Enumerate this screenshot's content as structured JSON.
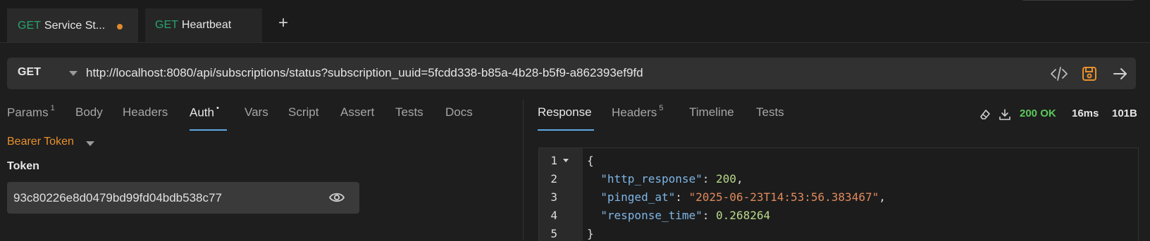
{
  "tabs": [
    {
      "method": "GET",
      "name": "Service St...",
      "unsaved": true
    },
    {
      "method": "GET",
      "name": "Heartbeat",
      "unsaved": false
    }
  ],
  "new_tab_label": "+",
  "request": {
    "method": "GET",
    "url": "http://localhost:8080/api/subscriptions/status?subscription_uuid=5fcdd338-b85a-4b28-b5f9-a862393ef9fd"
  },
  "request_tabs": {
    "params": "Params",
    "params_count": "1",
    "body": "Body",
    "headers": "Headers",
    "auth": "Auth",
    "auth_mark": "•",
    "vars": "Vars",
    "script": "Script",
    "assert": "Assert",
    "tests": "Tests",
    "docs": "Docs"
  },
  "auth": {
    "mode": "Bearer Token",
    "token_label": "Token",
    "token_value": "93c80226e8d0479bd99fd04bdb538c77"
  },
  "response_tabs": {
    "response": "Response",
    "headers": "Headers",
    "headers_count": "5",
    "timeline": "Timeline",
    "tests": "Tests"
  },
  "response_meta": {
    "status": "200 OK",
    "time": "16ms",
    "size": "101B"
  },
  "response_lines": {
    "numbers": [
      "1",
      "2",
      "3",
      "4",
      "5"
    ],
    "l1": "{",
    "l2_key": "\"http_response\"",
    "l2_val": "200",
    "l3_key": "\"pinged_at\"",
    "l3_val": "\"2025-06-23T14:53:56.383467\"",
    "l4_key": "\"response_time\"",
    "l4_val": "0.268264",
    "l5": "}"
  },
  "colors": {
    "accent": "#5ba9e8",
    "get_method": "#27a46d",
    "auth_mode": "#e8912c",
    "status_ok": "#5bc85b"
  }
}
